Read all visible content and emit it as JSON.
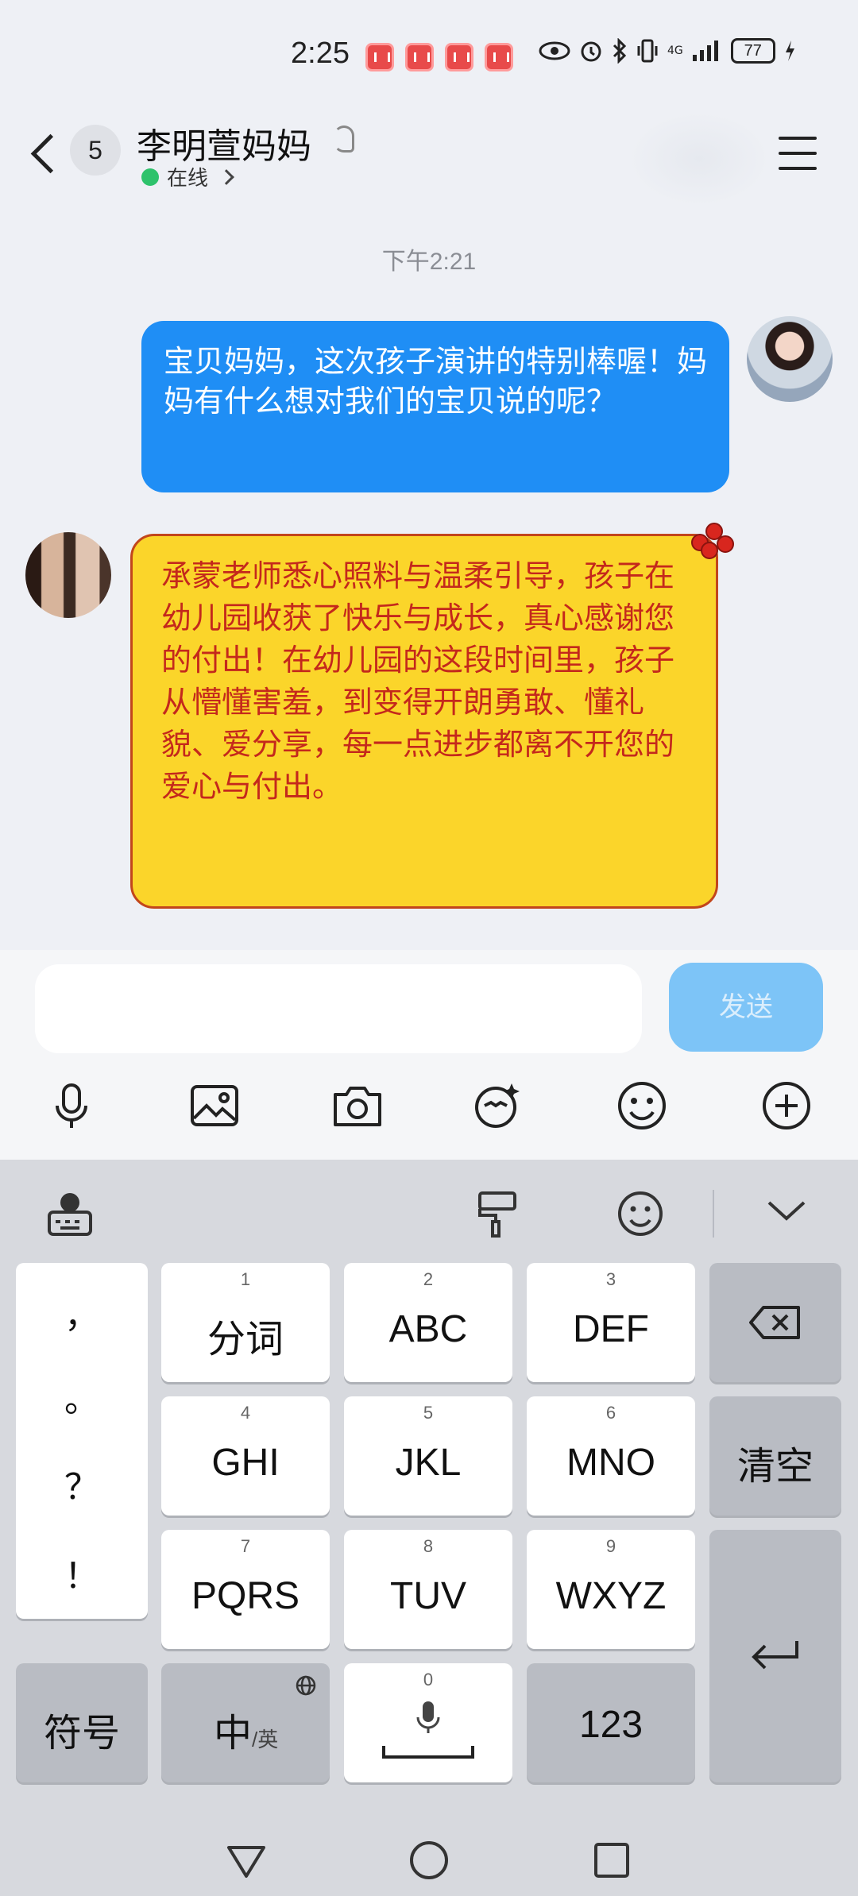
{
  "status_bar": {
    "time": "2:25",
    "network": "4G",
    "battery": "77"
  },
  "header": {
    "unread_count": "5",
    "contact_name": "李明萱妈妈",
    "status": "在线"
  },
  "chat": {
    "timestamp": "下午2:21",
    "messages": [
      {
        "side": "outgoing",
        "text": "宝贝妈妈，这次孩子演讲的特别棒喔！妈妈有什么想对我们的宝贝说的呢？"
      },
      {
        "side": "incoming",
        "text": "承蒙老师悉心照料与温柔引导，孩子在幼儿园收获了快乐与成长，真心感谢您的付出！在幼儿园的这段时间里，孩子从懵懂害羞，到变得开朗勇敢、懂礼貌、爱分享，每一点进步都离不开您的爱心与付出。"
      }
    ]
  },
  "input": {
    "placeholder": "",
    "send_label": "发送"
  },
  "toolbar": {
    "items": [
      "microphone-icon",
      "image-icon",
      "camera-icon",
      "sticker-icon",
      "emoji-icon",
      "plus-icon"
    ]
  },
  "keyboard": {
    "punctuation": [
      "，",
      "。",
      "？",
      "！"
    ],
    "keys": [
      {
        "num": "1",
        "label": "分词"
      },
      {
        "num": "2",
        "label": "ABC"
      },
      {
        "num": "3",
        "label": "DEF"
      },
      {
        "num": "4",
        "label": "GHI"
      },
      {
        "num": "5",
        "label": "JKL"
      },
      {
        "num": "6",
        "label": "MNO"
      },
      {
        "num": "7",
        "label": "PQRS"
      },
      {
        "num": "8",
        "label": "TUV"
      },
      {
        "num": "9",
        "label": "WXYZ"
      }
    ],
    "clear_label": "清空",
    "symbols_label": "符号",
    "lang_main": "中",
    "lang_sub": "/英",
    "space_num": "0",
    "numbers_label": "123"
  }
}
